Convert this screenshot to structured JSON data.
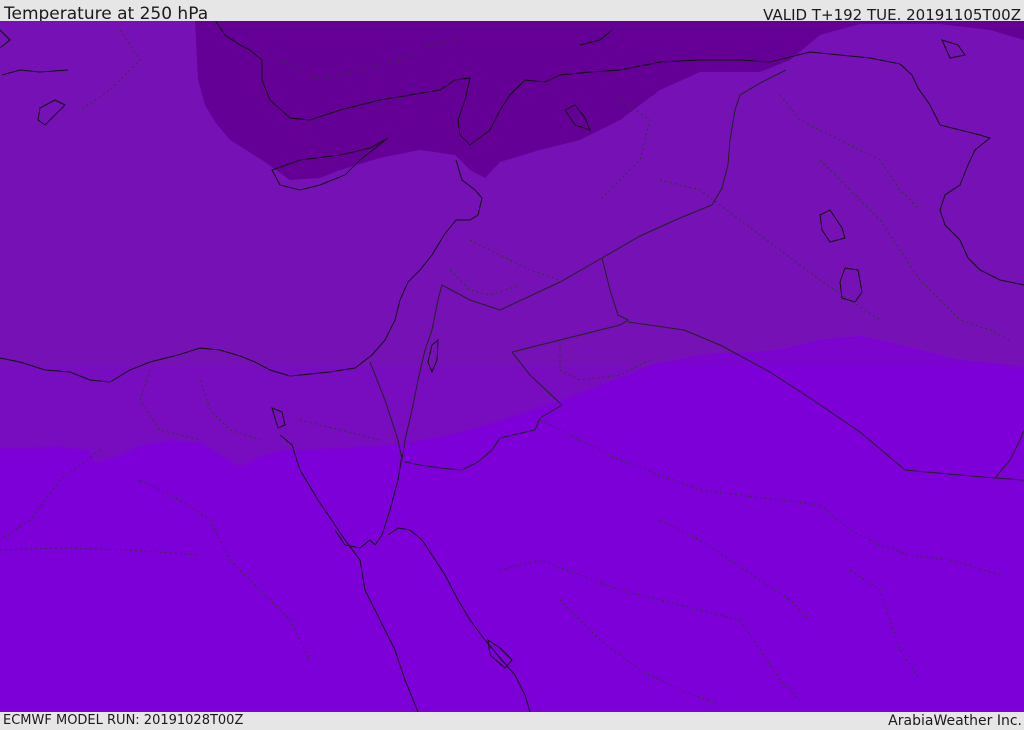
{
  "header": {
    "title": "Temperature at 250 hPa",
    "valid_time": "VALID T+192 TUE. 20191105T00Z"
  },
  "footer": {
    "model_run": "ECMWF MODEL RUN: 20191028T00Z",
    "credit": "ArabiaWeather Inc."
  },
  "map": {
    "colors": {
      "coldest_band": "#650097",
      "cold_band": "#7612b5",
      "mid_band": "#7a0ac7",
      "warm_band": "#7e00d8",
      "coastline": "#111111",
      "border": "#222222"
    }
  }
}
